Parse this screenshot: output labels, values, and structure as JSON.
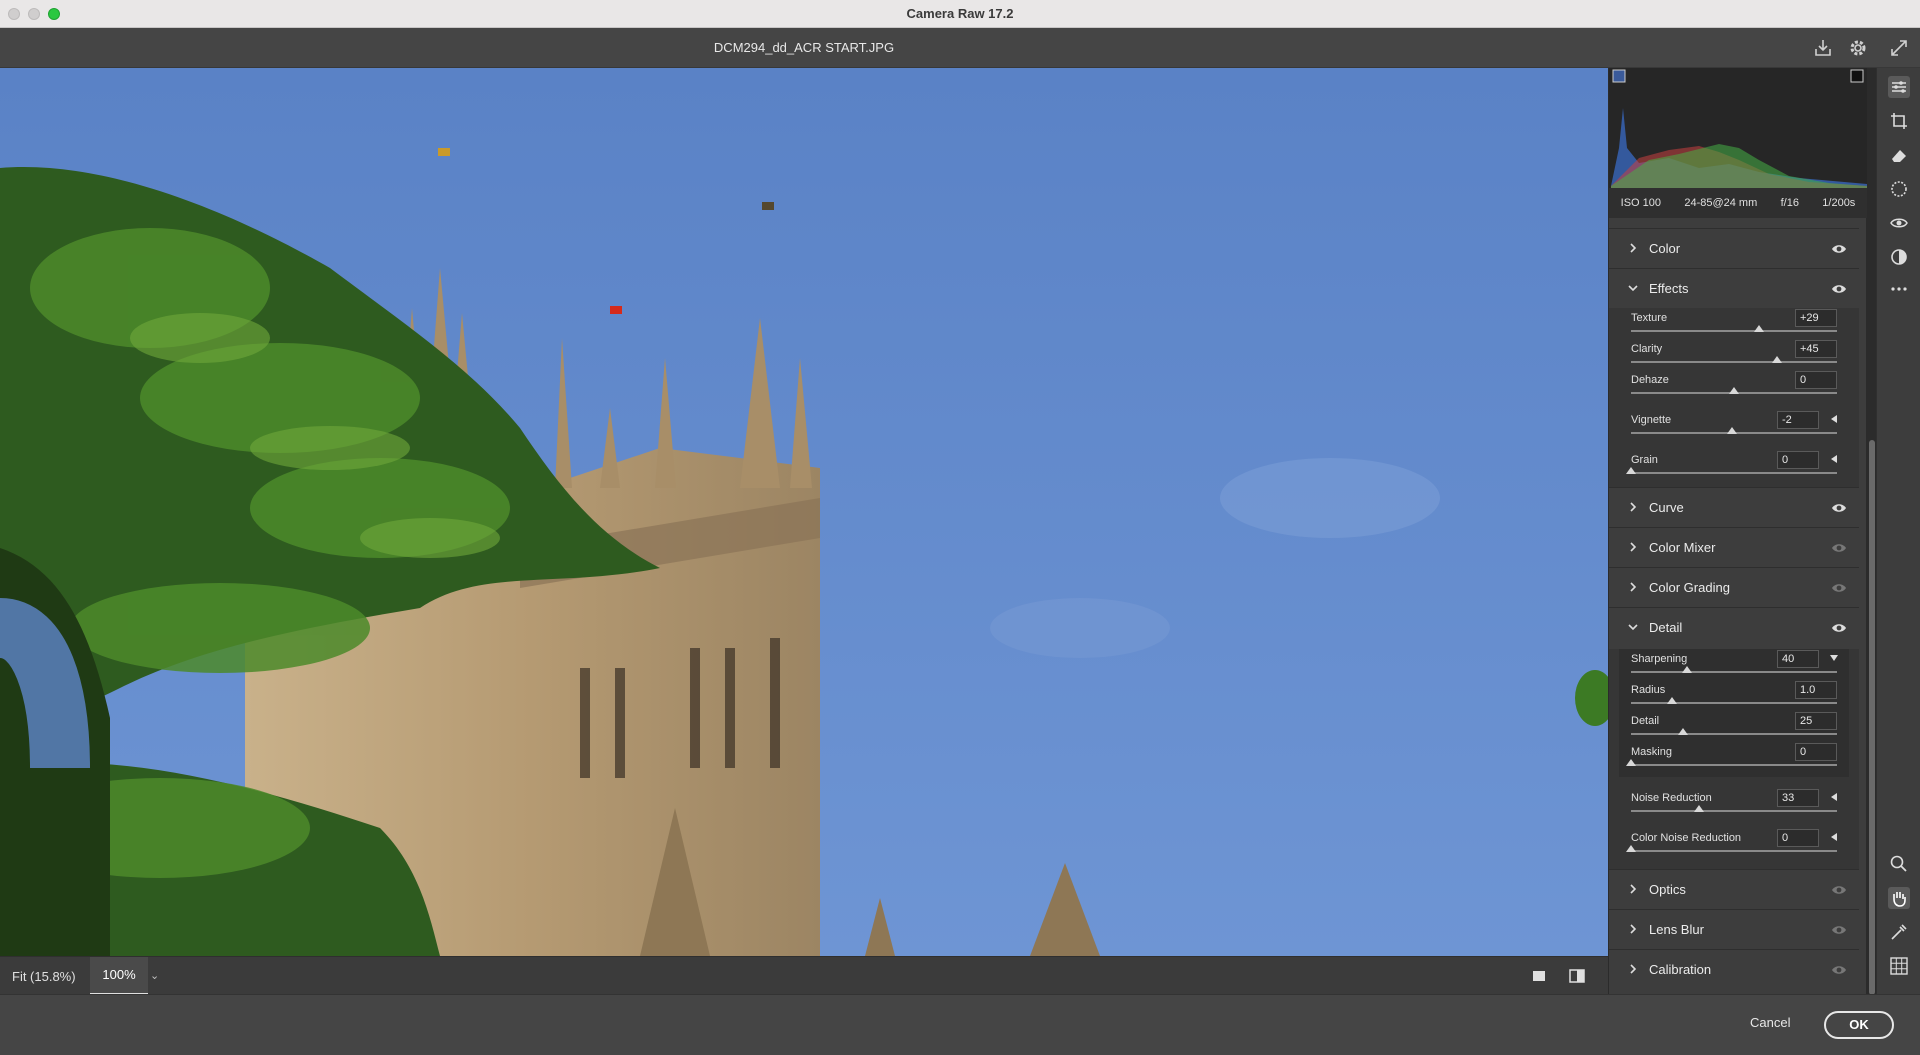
{
  "window": {
    "title": "Camera Raw 17.2"
  },
  "file": {
    "name": "DCM294_dd_ACR START.JPG"
  },
  "exif": {
    "iso": "ISO 100",
    "lens": "24-85@24 mm",
    "aperture": "f/16",
    "shutter": "1/200s"
  },
  "zoom": {
    "fit_label": "Fit (15.8%)",
    "current": "100%"
  },
  "panels": {
    "color": {
      "label": "Color"
    },
    "effects": {
      "label": "Effects",
      "sliders": [
        {
          "label": "Texture",
          "value": "+29",
          "pos": 0.62
        },
        {
          "label": "Clarity",
          "value": "+45",
          "pos": 0.71
        },
        {
          "label": "Dehaze",
          "value": "0",
          "pos": 0.5
        },
        {
          "label": "Vignette",
          "value": "-2",
          "pos": 0.49
        },
        {
          "label": "Grain",
          "value": "0",
          "pos": 0.0
        }
      ]
    },
    "curve": {
      "label": "Curve"
    },
    "color_mixer": {
      "label": "Color Mixer"
    },
    "color_grading": {
      "label": "Color Grading"
    },
    "detail": {
      "label": "Detail",
      "sliders": [
        {
          "label": "Sharpening",
          "value": "40",
          "pos": 0.27
        },
        {
          "label": "Radius",
          "value": "1.0",
          "pos": 0.2
        },
        {
          "label": "Detail",
          "value": "25",
          "pos": 0.25
        },
        {
          "label": "Masking",
          "value": "0",
          "pos": 0.0
        },
        {
          "label": "Noise Reduction",
          "value": "33",
          "pos": 0.33
        },
        {
          "label": "Color Noise Reduction",
          "value": "0",
          "pos": 0.0
        }
      ]
    },
    "optics": {
      "label": "Optics"
    },
    "lens_blur": {
      "label": "Lens Blur"
    },
    "calibration": {
      "label": "Calibration"
    }
  },
  "footer": {
    "cancel": "Cancel",
    "ok": "OK"
  },
  "colors": {
    "sky": "#5e86c9",
    "panel": "#3d3d3d",
    "accent": "#e8e8e8"
  }
}
